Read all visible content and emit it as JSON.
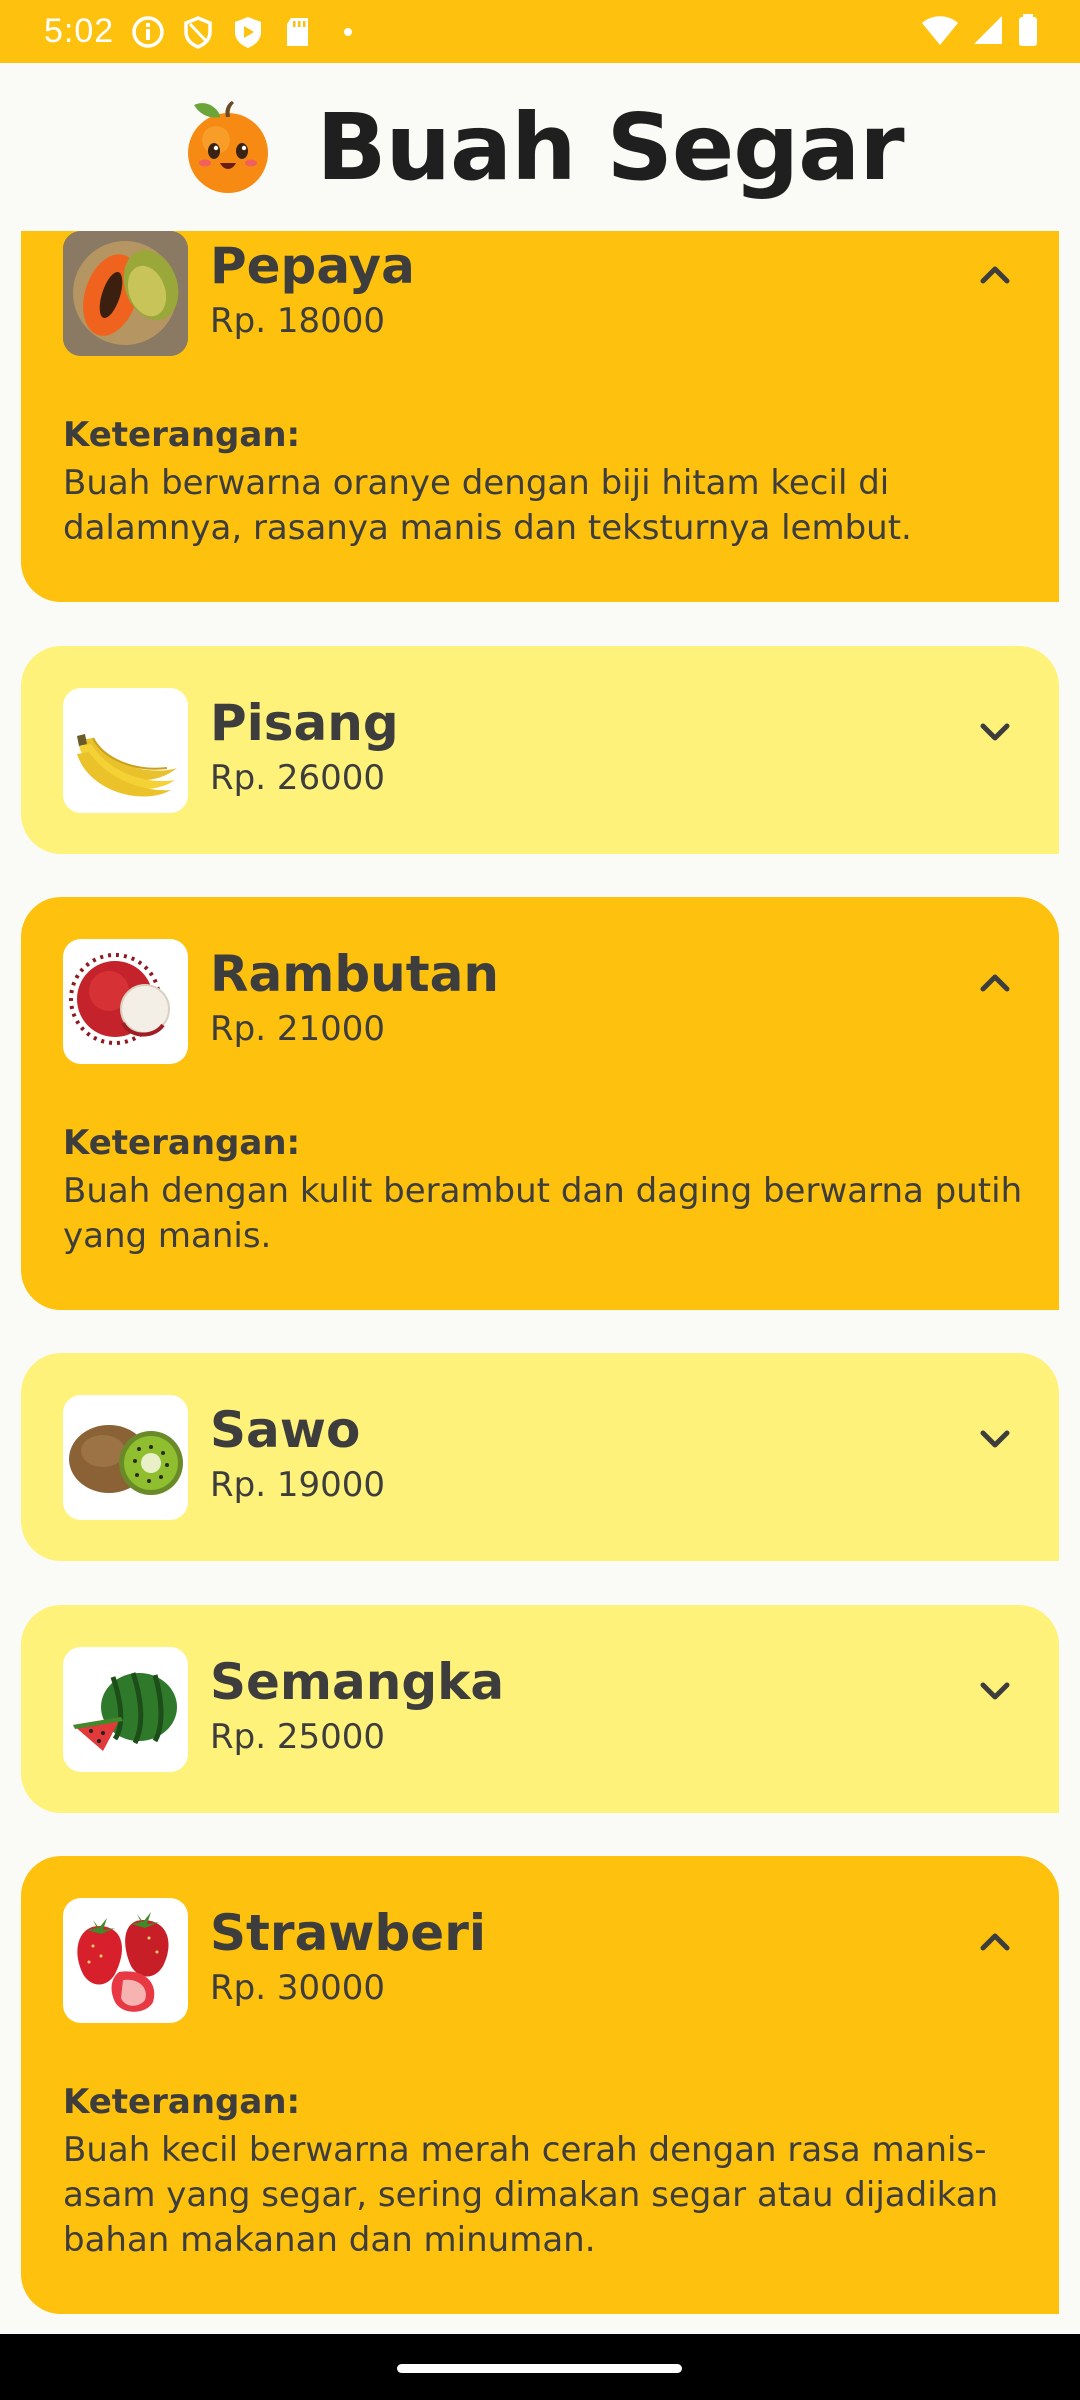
{
  "status_bar": {
    "time": "5:02",
    "background": "#FDC10E",
    "left_icons": [
      "info-icon",
      "shield-icon",
      "play-shield-icon",
      "sd-card-icon",
      "dot-icon"
    ],
    "right_icons": [
      "wifi-icon",
      "signal-icon",
      "battery-icon"
    ]
  },
  "app_bar": {
    "title": "Buah Segar",
    "logo": "orange-mascot-icon"
  },
  "colors": {
    "expanded_card": "#FDC10E",
    "collapsed_card": "#FEF27B",
    "text": "#3d3d3d"
  },
  "fruits": [
    {
      "name": "Pepaya",
      "price": "Rp. 18000",
      "expanded": true,
      "description_label": "Keterangan:",
      "description": "Buah berwarna oranye dengan biji hitam kecil di dalamnya, rasanya manis dan teksturnya lembut.",
      "image": "papaya"
    },
    {
      "name": "Pisang",
      "price": "Rp. 26000",
      "expanded": false,
      "image": "banana"
    },
    {
      "name": "Rambutan",
      "price": "Rp. 21000",
      "expanded": true,
      "description_label": "Keterangan:",
      "description": "Buah dengan kulit berambut dan daging berwarna putih yang manis.",
      "image": "rambutan"
    },
    {
      "name": "Sawo",
      "price": "Rp. 19000",
      "expanded": false,
      "image": "sapodilla-kiwi"
    },
    {
      "name": "Semangka",
      "price": "Rp. 25000",
      "expanded": false,
      "image": "watermelon"
    },
    {
      "name": "Strawberi",
      "price": "Rp. 30000",
      "expanded": true,
      "description_label": "Keterangan:",
      "description": "Buah kecil berwarna merah cerah dengan rasa manis-asam yang segar, sering dimakan segar atau dijadikan bahan makanan dan minuman.",
      "image": "strawberry"
    }
  ]
}
